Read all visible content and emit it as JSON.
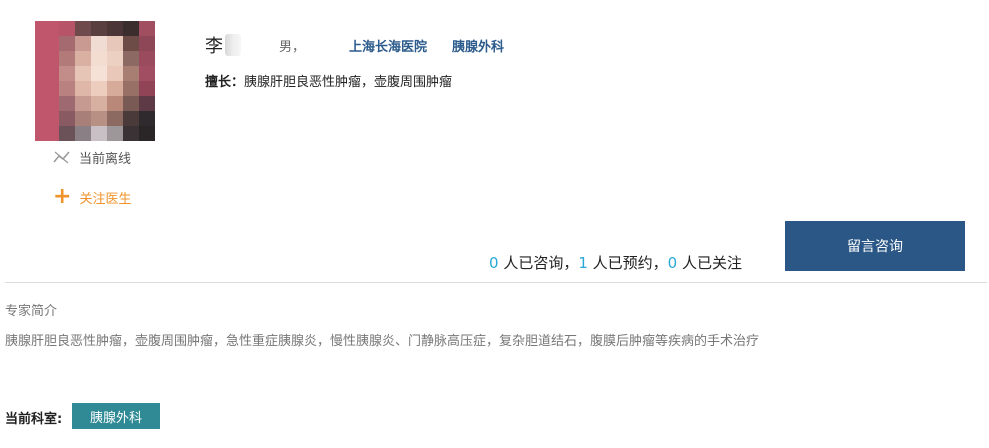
{
  "doctor": {
    "name": "李",
    "gender": "男，",
    "hospital": "上海长海医院",
    "department": "胰腺外科",
    "expertise_label": "擅长：",
    "expertise_text": "胰腺肝胆良恶性肿瘤，壶腹周围肿瘤"
  },
  "status": {
    "online_text": "当前离线",
    "follow_text": "关注医生",
    "follow_icon": "plus-icon",
    "status_icon": "offline-chart-icon"
  },
  "stats": {
    "consult_count": "0",
    "consult_text": " 人已咨询，",
    "appointment_count": "1",
    "appointment_text": " 人已预约，",
    "follow_count": "0",
    "follow_text": " 人已关注"
  },
  "consult_button": {
    "label": "留言咨询"
  },
  "intro": {
    "title": "专家简介",
    "text": "胰腺肝胆良恶性肿瘤，壶腹周围肿瘤，急性重症胰腺炎，慢性胰腺炎、门静脉高压症，复杂胆道结石，腹膜后肿瘤等疾病的手术治疗"
  },
  "current_department": {
    "label": "当前科室:",
    "value": "胰腺外科"
  },
  "colors": {
    "link_blue": "#2c5b8c",
    "button_bg": "#2a5785",
    "accent_orange": "#f0932b",
    "count_cyan": "#29a9d6",
    "tag_teal": "#2f8a96"
  }
}
